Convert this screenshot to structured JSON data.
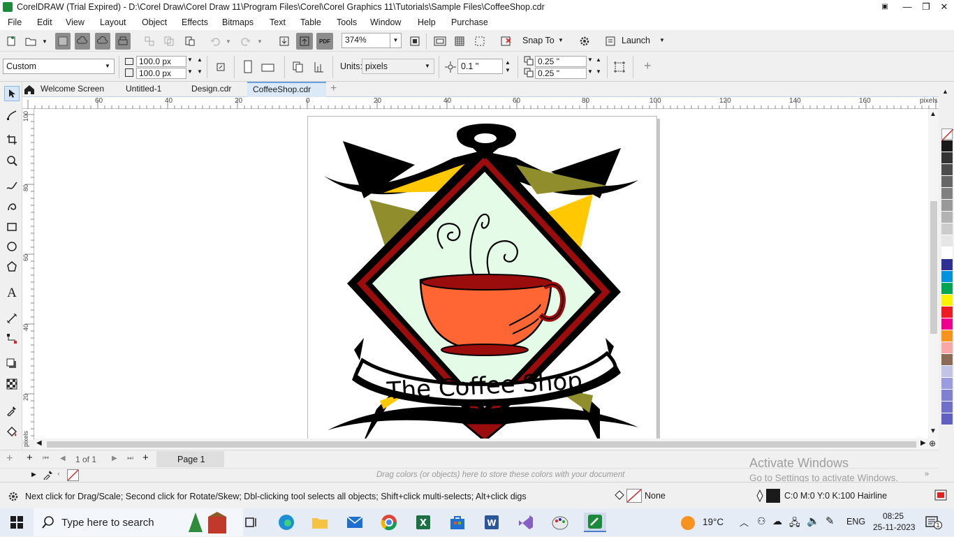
{
  "titlebar": {
    "title": "CorelDRAW (Trial Expired) - D:\\Corel Draw\\Corel Draw 11\\Program Files\\Corel\\Corel Graphics 11\\Tutorials\\Sample Files\\CoffeeShop.cdr"
  },
  "menu": [
    "File",
    "Edit",
    "View",
    "Layout",
    "Object",
    "Effects",
    "Bitmaps",
    "Text",
    "Table",
    "Tools",
    "Window",
    "Help",
    "Purchase"
  ],
  "toolbar1": {
    "zoom_value": "374%",
    "snap_to": "Snap To",
    "launch": "Launch",
    "pdf_label": "PDF"
  },
  "toolbar2": {
    "preset": "Custom",
    "width": "100.0 px",
    "height": "100.0 px",
    "units_label": "Units:",
    "units_value": "pixels",
    "nudge": "0.1 \"",
    "dup_x": "0.25 \"",
    "dup_y": "0.25 \""
  },
  "tabs": [
    {
      "label": "Welcome Screen"
    },
    {
      "label": "Untitled-1"
    },
    {
      "label": "Design.cdr"
    },
    {
      "label": "CoffeeShop.cdr"
    }
  ],
  "ruler": {
    "h_ticks": [
      "60",
      "40",
      "20",
      "0",
      "20",
      "40",
      "60",
      "80",
      "100",
      "120",
      "140",
      "160"
    ],
    "h_unit": "pixels",
    "v_ticks": [
      "100",
      "80",
      "60",
      "40",
      "20"
    ],
    "v_unit": "pixels"
  },
  "artwork": {
    "text": "The Coffee Shop",
    "colors": {
      "black": "#000000",
      "red": "#9b0d0d",
      "olive": "#8f8d2c",
      "yellow": "#ffc800",
      "mint": "#e4fbe8",
      "cup": "#ff6633",
      "cup_dark": "#a10a0a"
    }
  },
  "pagebar": {
    "page_of": "1 of 1",
    "page_tab": "Page 1"
  },
  "docpalette": {
    "hint": "Drag colors (or objects) here to store these colors with your document"
  },
  "watermark": {
    "line1": "Activate Windows",
    "line2": "Go to Settings to activate Windows."
  },
  "status": {
    "message": "Next click for Drag/Scale; Second click for Rotate/Skew; Dbl-clicking tool selects all objects; Shift+click multi-selects; Alt+click digs",
    "fill_label": "None",
    "outline_label": "C:0 M:0 Y:0 K:100  Hairline"
  },
  "palette_colors": [
    "#1a1a1a",
    "#333333",
    "#4d4d4d",
    "#666666",
    "#808080",
    "#999999",
    "#b3b3b3",
    "#cccccc",
    "#e6e6e6",
    "#ffffff",
    "#2e3192",
    "#0093dd",
    "#00a651",
    "#fff200",
    "#ed1c24",
    "#ec008c",
    "#f7941d",
    "#f9a6a6",
    "#8c6b55",
    "#c3c3e6",
    "#9b9be0",
    "#8080d0",
    "#7070c8",
    "#6060c0"
  ],
  "taskbar": {
    "search_placeholder": "Type here to search",
    "weather": "19°C",
    "lang": "ENG",
    "time": "08:25",
    "date": "25-11-2023",
    "notif_count": "1"
  }
}
